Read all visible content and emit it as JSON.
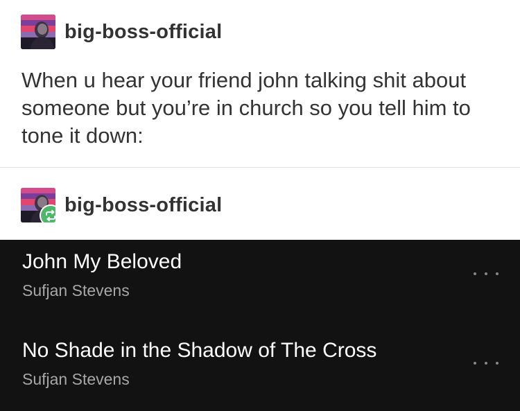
{
  "post": {
    "author": "big-boss-official",
    "text": "When u hear your friend john talking shit about someone but you’re in church so you tell him to tone it down:"
  },
  "reblog": {
    "author": "big-boss-official"
  },
  "player": {
    "tracks": [
      {
        "title": "John My Beloved",
        "artist": "Sufjan Stevens"
      },
      {
        "title": "No Shade in the Shadow of The Cross",
        "artist": "Sufjan Stevens"
      }
    ]
  },
  "icons": {
    "avatar": "avatar-image",
    "reblog": "reblog-icon",
    "more": "more-options-icon"
  },
  "colors": {
    "text": "#333333",
    "player_background": "#121212",
    "reblog_badge": "#4cb96a",
    "artist_text": "#a7a7a7"
  }
}
